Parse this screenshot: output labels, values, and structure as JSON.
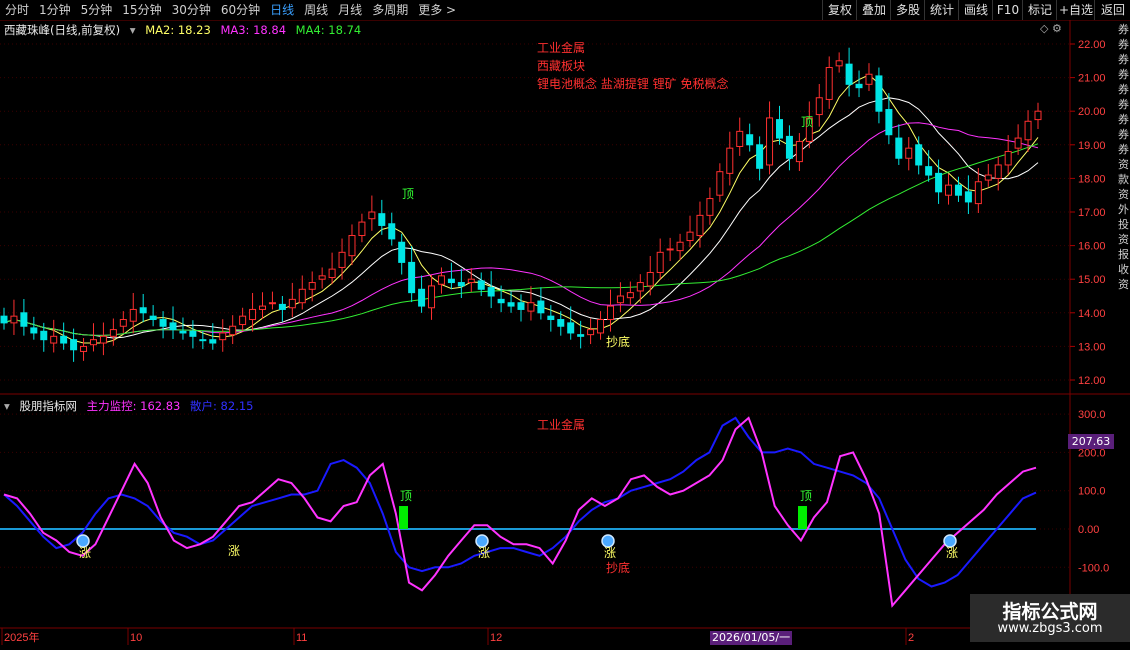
{
  "toolbar": {
    "timeframes": [
      "分时",
      "1分钟",
      "5分钟",
      "15分钟",
      "30分钟",
      "60分钟",
      "日线",
      "周线",
      "月线",
      "多周期",
      "更多 >"
    ],
    "active": "日线",
    "right_buttons": [
      "复权",
      "叠加",
      "多股",
      "统计",
      "画线",
      "F10",
      "标记",
      "+自选",
      "返回"
    ]
  },
  "price_panel": {
    "title": "西藏珠峰(日线,前复权)",
    "ma2": "MA2: 18.23",
    "ma3": "MA3: 18.84",
    "ma4": "MA4: 18.74",
    "annotations": [
      "工业金属",
      "西藏板块",
      "锂电池概念 盐湖提锂 锂矿 免税概念"
    ],
    "top_label": "顶",
    "bottom_label": "抄底",
    "y_ticks": [
      "22.00",
      "21.00",
      "20.00",
      "19.00",
      "18.00",
      "17.00",
      "16.00",
      "15.00",
      "14.00",
      "13.00",
      "12.00"
    ]
  },
  "indicator_panel": {
    "title": "股朋指标网",
    "main_label": "主力监控: 162.83",
    "retail_label": "散户: 82.15",
    "annotation": "工业金属",
    "current_value": "207.63",
    "up_label": "涨",
    "top_label": "顶",
    "bottom_label": "抄底",
    "y_ticks": [
      "300.0",
      "200.0",
      "100.0",
      "0.00",
      "-100.0"
    ]
  },
  "x_axis": {
    "labels": [
      "2025年",
      "10",
      "11",
      "12",
      "2026/01/05/一",
      "2"
    ]
  },
  "side_chars": [
    "券",
    "券",
    "券",
    "券",
    "券",
    "券",
    "券",
    "券",
    "券",
    "资",
    "款",
    "资",
    "外",
    "投",
    "资",
    "报",
    "收",
    "资"
  ],
  "watermark": {
    "title": "指标公式网",
    "url": "www.zbgs3.com"
  },
  "colors": {
    "up": "#ff3030",
    "down": "#00e5e5",
    "ma2": "#ffff66",
    "ma3": "#ff33ff",
    "ma4": "#33ee33",
    "main": "#ff33ff",
    "retail": "#1a1aff",
    "zero_line": "#1a9ad6"
  },
  "chart_data": {
    "type": "candlestick",
    "series_names": [
      "MA2",
      "MA3",
      "MA4"
    ],
    "closes": [
      13.7,
      13.9,
      13.6,
      13.4,
      13.2,
      13.3,
      13.1,
      12.9,
      13.0,
      13.2,
      13.3,
      13.5,
      13.8,
      14.1,
      14.0,
      13.8,
      13.6,
      13.5,
      13.4,
      13.3,
      13.2,
      13.1,
      13.4,
      13.6,
      13.9,
      14.1,
      14.2,
      14.3,
      14.1,
      14.4,
      14.7,
      14.9,
      15.1,
      15.3,
      15.8,
      16.3,
      16.7,
      17.0,
      16.6,
      16.2,
      15.5,
      14.6,
      14.2,
      14.8,
      15.1,
      14.9,
      14.8,
      15.0,
      14.7,
      14.5,
      14.3,
      14.2,
      14.1,
      14.3,
      14.0,
      13.8,
      13.6,
      13.4,
      13.3,
      13.5,
      13.8,
      14.2,
      14.5,
      14.6,
      14.9,
      15.2,
      15.8,
      15.9,
      16.1,
      16.4,
      16.9,
      17.4,
      18.2,
      18.9,
      19.4,
      19.0,
      18.3,
      19.8,
      19.2,
      18.6,
      19.1,
      19.8,
      20.4,
      21.3,
      21.5,
      20.8,
      20.7,
      21.1,
      20.0,
      19.3,
      18.6,
      18.9,
      18.4,
      18.1,
      17.6,
      17.8,
      17.5,
      17.3,
      17.9,
      18.1,
      18.4,
      18.8,
      19.2,
      19.7,
      20.0
    ],
    "main_indicator": [
      90,
      80,
      40,
      -10,
      -30,
      -60,
      -70,
      -40,
      30,
      100,
      170,
      120,
      30,
      -30,
      -50,
      -40,
      -20,
      20,
      60,
      70,
      100,
      130,
      120,
      80,
      30,
      20,
      60,
      70,
      140,
      170,
      40,
      -140,
      -160,
      -120,
      -70,
      -30,
      10,
      10,
      -20,
      -40,
      -40,
      -50,
      -90,
      -30,
      50,
      80,
      60,
      80,
      130,
      140,
      110,
      90,
      100,
      120,
      140,
      180,
      260,
      290,
      200,
      60,
      10,
      -30,
      30,
      70,
      190,
      200,
      130,
      40,
      -200,
      -160,
      -120,
      -80,
      -40,
      -10,
      20,
      50,
      90,
      120,
      150,
      160
    ],
    "retail_indicator": [
      90,
      60,
      20,
      -20,
      -50,
      -40,
      -10,
      40,
      80,
      90,
      80,
      60,
      20,
      -10,
      -20,
      -40,
      -30,
      0,
      30,
      60,
      70,
      80,
      90,
      90,
      100,
      170,
      180,
      160,
      120,
      40,
      -60,
      -100,
      -110,
      -100,
      -100,
      -90,
      -70,
      -60,
      -50,
      -50,
      -60,
      -70,
      -50,
      -20,
      20,
      50,
      70,
      80,
      100,
      110,
      120,
      130,
      150,
      180,
      200,
      270,
      290,
      240,
      200,
      200,
      210,
      200,
      170,
      160,
      150,
      140,
      120,
      80,
      0,
      -80,
      -130,
      -150,
      -140,
      -120,
      -80,
      -40,
      0,
      40,
      80,
      95
    ]
  }
}
